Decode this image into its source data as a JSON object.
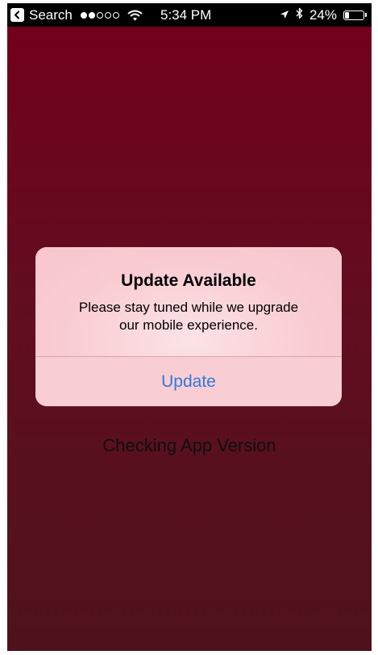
{
  "status_bar": {
    "back_label": "Search",
    "signal": {
      "filled": 2,
      "total": 5
    },
    "time": "5:34 PM",
    "battery_text": "24%",
    "battery_level": 0.24,
    "icons": [
      "back-arrow-icon",
      "wifi-icon",
      "location-arrow-icon",
      "bluetooth-icon",
      "battery-icon"
    ]
  },
  "screen": {
    "status_text": "Checking App Version"
  },
  "alert": {
    "title": "Update Available",
    "message_line1": "Please stay tuned while we upgrade",
    "message_line2": "our mobile experience.",
    "button_label": "Update"
  },
  "colors": {
    "background_top": "#800020",
    "background_bottom": "#581520",
    "alert_background": "#f9cdd4",
    "button_text": "#2f7ad8"
  }
}
